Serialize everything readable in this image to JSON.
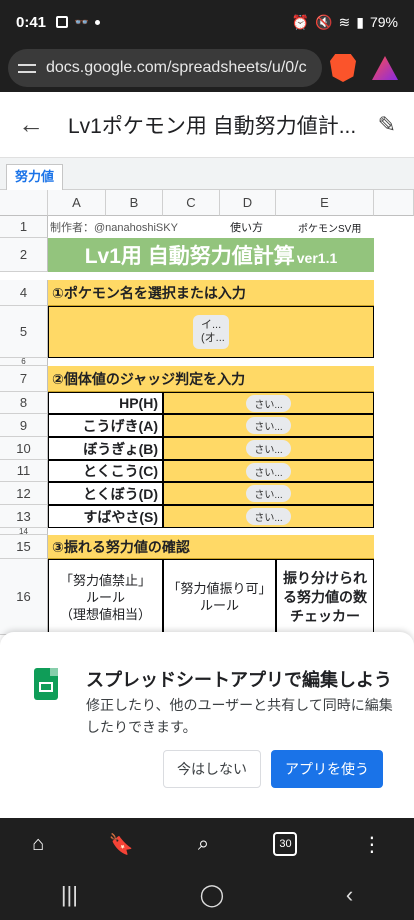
{
  "status": {
    "time": "0:41",
    "battery": "79%"
  },
  "browser": {
    "url": "docs.google.com/spreadsheets/u/0/c"
  },
  "appbar": {
    "title": "Lv1ポケモン用 自動努力値計..."
  },
  "sheet_tab": "努力値",
  "columns": [
    "A",
    "B",
    "C",
    "D",
    "E"
  ],
  "rows": [
    "1",
    "2",
    "4",
    "5",
    "6",
    "7",
    "8",
    "9",
    "10",
    "11",
    "12",
    "13",
    "14",
    "15",
    "16"
  ],
  "sheet": {
    "author": "制作者：@nanahoshiSKY",
    "usage": "使い方",
    "version_label": "ポケモンSV用",
    "title": "Lv1用 自動努力値計算",
    "title_ver": "ver1.1",
    "step1": "①ポケモン名を選択または入力",
    "step1_chip": "イ...(オ...",
    "step2": "②個体値のジャッジ判定を入力",
    "stats": [
      {
        "label": "HP(H)",
        "chip": "さい..."
      },
      {
        "label": "こうげき(A)",
        "chip": "さい..."
      },
      {
        "label": "ぼうぎょ(B)",
        "chip": "さい..."
      },
      {
        "label": "とくこう(C)",
        "chip": "さい..."
      },
      {
        "label": "とくぼう(D)",
        "chip": "さい..."
      },
      {
        "label": "すばやさ(S)",
        "chip": "さい..."
      }
    ],
    "step3": "③振れる努力値の確認",
    "box1_l1": "「努力値禁止」",
    "box1_l2": "ルール",
    "box1_l3": "（理想値相当）",
    "box2_l1": "「努力値振り可」",
    "box2_l2": "ルール",
    "box3": "振り分けられる努力値の数チェッカー"
  },
  "banner": {
    "title": "スプレッドシートアプリで編集しよう",
    "desc": "修正したり、他のユーザーと共有して同時に編集したりできます。",
    "later": "今はしない",
    "use_app": "アプリを使う"
  },
  "bottom": {
    "tabs": "30"
  },
  "colors": {
    "yellow": "#ffd966",
    "green": "#93c47d",
    "accent": "#1a73e8"
  }
}
